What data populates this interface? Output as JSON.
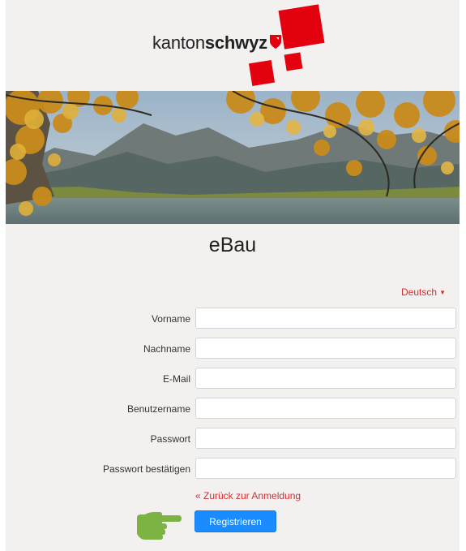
{
  "header": {
    "logo_text_light": "kanton",
    "logo_text_bold": "schwyz",
    "brand_red": "#e3000f"
  },
  "app": {
    "title": "eBau"
  },
  "language": {
    "selected": "Deutsch",
    "caret_icon": "caret-down-icon"
  },
  "form": {
    "fields": [
      {
        "label": "Vorname",
        "value": ""
      },
      {
        "label": "Nachname",
        "value": ""
      },
      {
        "label": "E-Mail",
        "value": ""
      },
      {
        "label": "Benutzername",
        "value": ""
      },
      {
        "label": "Passwort",
        "value": ""
      },
      {
        "label": "Passwort bestätigen",
        "value": ""
      }
    ],
    "back_link": "« Zurück zur Anmeldung",
    "submit_label": "Registrieren",
    "accent_color": "#1a8cff",
    "link_color": "#d32f2f"
  },
  "annotation": {
    "pointer_icon": "pointing-hand-icon",
    "pointer_color": "#7cb342"
  }
}
